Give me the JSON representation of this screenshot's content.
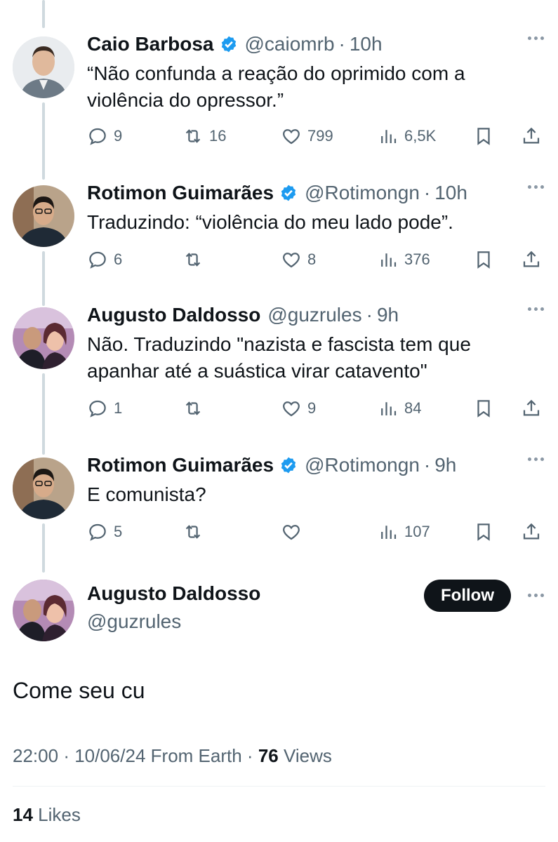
{
  "replies": [
    {
      "name": "Caio Barbosa",
      "verified": true,
      "handle": "@caiomrb",
      "time": "10h",
      "text": "“Não confunda a reação do oprimido com a violência do opressor.”",
      "replies": "9",
      "reposts": "16",
      "likes": "799",
      "views": "6,5K"
    },
    {
      "name": "Rotimon Guimarães",
      "verified": true,
      "handle": "@Rotimongn",
      "time": "10h",
      "text": "Traduzindo: “violência do meu lado pode”.",
      "replies": "6",
      "reposts": "",
      "likes": "8",
      "views": "376"
    },
    {
      "name": "Augusto Daldosso",
      "verified": false,
      "handle": "@guzrules",
      "time": "9h",
      "text": "Não. Traduzindo \"nazista e fascista tem que apanhar até a suástica virar catavento\"",
      "replies": "1",
      "reposts": "",
      "likes": "9",
      "views": "84"
    },
    {
      "name": "Rotimon Guimarães",
      "verified": true,
      "handle": "@Rotimongn",
      "time": "9h",
      "text": "E comunista?",
      "replies": "5",
      "reposts": "",
      "likes": "",
      "views": "107"
    }
  ],
  "main_tweet": {
    "name": "Augusto Daldosso",
    "handle": "@guzrules",
    "follow_label": "Follow",
    "text": "Come seu cu",
    "time": "22:00",
    "date": "10/06/24",
    "source": "From Earth",
    "views_count": "76",
    "views_label": "Views",
    "likes_count": "14",
    "likes_label": "Likes"
  },
  "colors": {
    "text": "#0f1419",
    "muted": "#536471",
    "verified": "#1d9bf0",
    "thread_line": "#cfd9de",
    "follow_bg": "#0f1419"
  },
  "icons": [
    "reply-icon",
    "repost-icon",
    "like-icon",
    "views-icon",
    "bookmark-icon",
    "share-icon",
    "verified-badge-icon",
    "more-icon"
  ]
}
